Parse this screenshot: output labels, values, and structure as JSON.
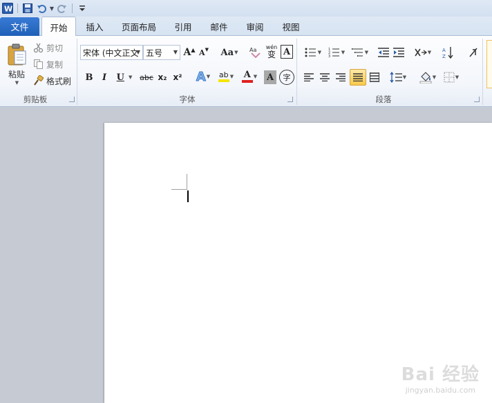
{
  "quick_access": {
    "icons": [
      "word-app-icon",
      "save-icon",
      "undo-icon",
      "redo-icon",
      "customize-qat-icon"
    ]
  },
  "tabs": {
    "file": "文件",
    "items": [
      "开始",
      "插入",
      "页面布局",
      "引用",
      "邮件",
      "审阅",
      "视图"
    ],
    "active": "开始"
  },
  "clipboard": {
    "paste_label": "粘贴",
    "cut_label": "剪切",
    "copy_label": "复制",
    "format_painter_label": "格式刷",
    "group_label": "剪贴板"
  },
  "font": {
    "font_name": "宋体 (中文正文",
    "font_size": "五号",
    "grow_label": "A",
    "shrink_label": "A",
    "change_case_label": "Aa",
    "bold": "B",
    "italic": "I",
    "underline": "U",
    "strike": "abc",
    "subscript": "x₂",
    "superscript": "x²",
    "text_effect": "A",
    "highlight": "ab",
    "font_color": "A",
    "char_shading": "A",
    "enclose_char": "字",
    "phonetic": "wén",
    "phonetic_char": "变",
    "char_border": "A",
    "group_label": "字体",
    "font_color_hex": "#e02020",
    "highlight_hex": "#f5e400"
  },
  "paragraph": {
    "group_label": "段落",
    "active_align": "justify",
    "active_hex": "#fbd35a"
  },
  "watermark": {
    "main": "Bai 经验",
    "sub": "jingyan.baidu.com"
  }
}
